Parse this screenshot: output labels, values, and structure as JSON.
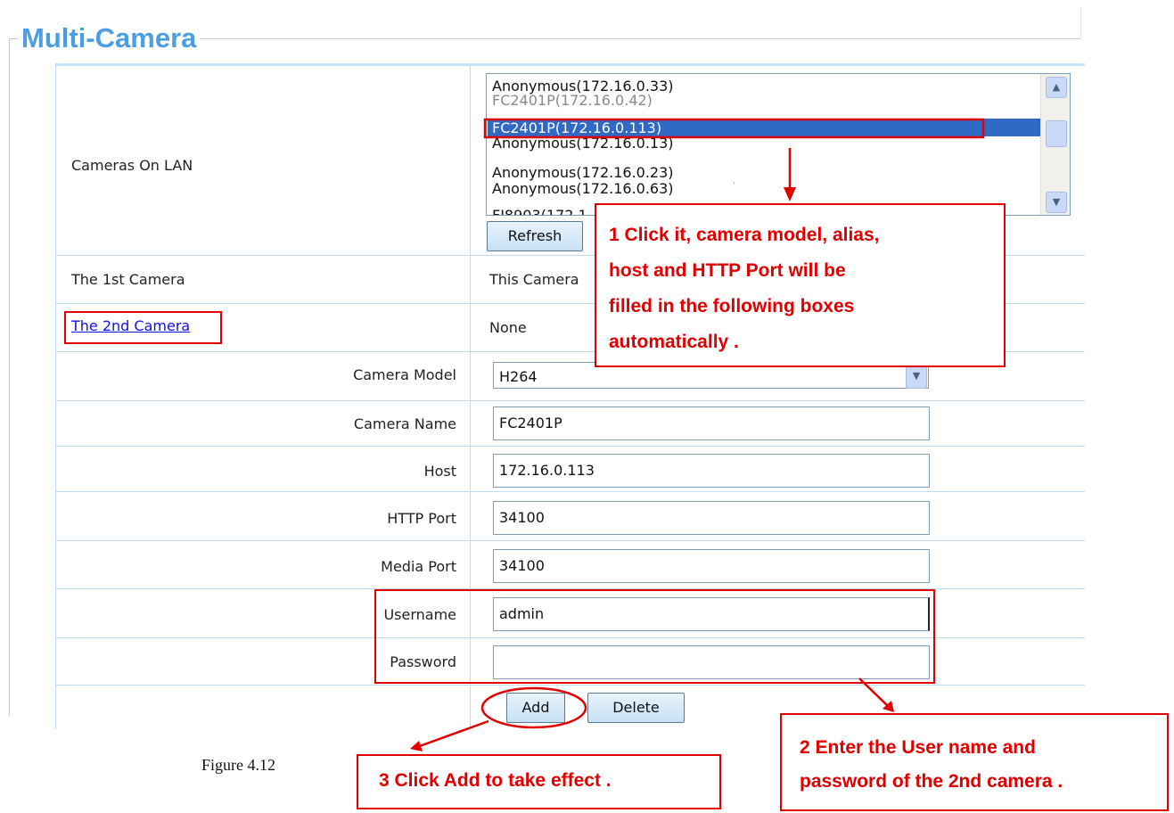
{
  "page_title": "Multi-Camera",
  "labels": {
    "cameras_on_lan": "Cameras On LAN",
    "first_camera": "The 1st Camera",
    "second_camera_link": "The 2nd Camera",
    "camera_model": "Camera Model",
    "camera_name": "Camera Name",
    "host": "Host",
    "http_port": "HTTP Port",
    "media_port": "Media Port",
    "username": "Username",
    "password": "Password"
  },
  "camera_list": {
    "items": [
      {
        "label": "Anonymous(172.16.0.33)",
        "gray": false,
        "selected": false
      },
      {
        "label": "FC2401P(172.16.0.42)",
        "gray": true,
        "selected": false
      },
      {
        "label": "FC2401P(172.16.0.113)",
        "gray": false,
        "selected": true
      },
      {
        "label": "Anonymous(172.16.0.13)",
        "gray": false,
        "selected": false
      },
      {
        "label": "Anonymous(172.16.0.23)",
        "gray": false,
        "selected": false
      },
      {
        "label": " Anonymous(172.16.0.63)",
        "gray": false,
        "selected": false
      },
      {
        "label": "FI8903(172.1",
        "gray": false,
        "selected": false
      }
    ]
  },
  "buttons": {
    "refresh": "Refresh",
    "add": "Add",
    "delete": "Delete"
  },
  "values": {
    "first_camera": "This Camera",
    "second_camera": "None",
    "camera_model": "H264",
    "camera_name": "FC2401P",
    "host": "172.16.0.113",
    "http_port": "34100",
    "media_port": "34100",
    "username": "admin",
    "password": ""
  },
  "callouts": {
    "c1": [
      "1 Click it, camera model, alias,",
      "host and HTTP Port will be",
      "filled in the following boxes",
      "automatically ."
    ],
    "c2": [
      "2 Enter the User name and",
      "password of the 2nd camera ."
    ],
    "c3": "3 Click Add to take effect ."
  },
  "figure_caption": "Figure 4.12",
  "colors": {
    "accent": "#4c9ee3",
    "annotation": "#e00000",
    "selection": "#316ac5"
  }
}
